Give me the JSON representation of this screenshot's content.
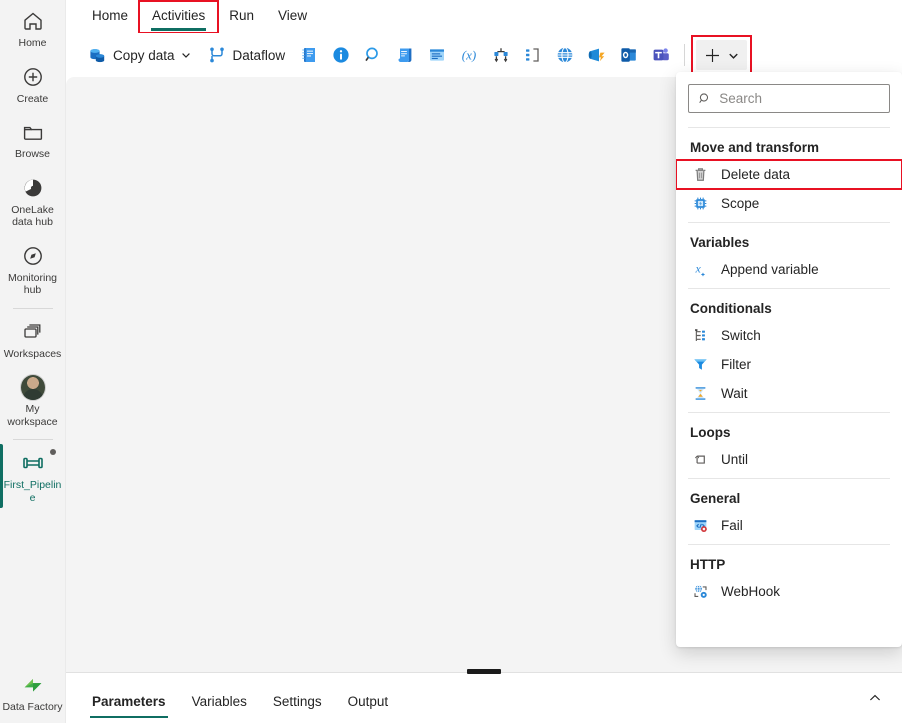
{
  "sidebar": {
    "items": [
      {
        "label": "Home",
        "icon": "home-icon",
        "active": false
      },
      {
        "label": "Create",
        "icon": "plus-circle-icon",
        "active": false
      },
      {
        "label": "Browse",
        "icon": "folder-icon",
        "active": false
      },
      {
        "label": "OneLake data hub",
        "icon": "onelake-icon",
        "active": false
      },
      {
        "label": "Monitoring hub",
        "icon": "monitoring-icon",
        "active": false
      },
      {
        "label": "Workspaces",
        "icon": "workspaces-icon",
        "active": false
      },
      {
        "label": "My workspace",
        "icon": "avatar-icon",
        "active": false
      },
      {
        "label": "First_Pipeline",
        "icon": "pipeline-icon",
        "active": true
      }
    ],
    "footer": {
      "label": "Data Factory",
      "icon": "data-factory-icon"
    }
  },
  "menubar": {
    "tabs": [
      {
        "label": "Home",
        "active": false,
        "highlighted": false
      },
      {
        "label": "Activities",
        "active": true,
        "highlighted": true
      },
      {
        "label": "Run",
        "active": false,
        "highlighted": false
      },
      {
        "label": "View",
        "active": false,
        "highlighted": false
      }
    ]
  },
  "toolbar": {
    "copy_data_label": "Copy data",
    "dataflow_label": "Dataflow",
    "icon_buttons": [
      "notebook-icon",
      "get-metadata-icon",
      "lookup-icon",
      "script-icon",
      "stored-procedure-icon",
      "set-variable-icon",
      "kql-icon",
      "if-condition-icon",
      "web-icon",
      "azure-function-icon",
      "outlook-icon",
      "teams-icon"
    ],
    "add_button": {
      "icon": "plus-icon",
      "chevron": "chevron-down-icon",
      "highlighted": true
    }
  },
  "flyout": {
    "search": {
      "placeholder": "Search",
      "value": "",
      "icon": "search-icon"
    },
    "groups": [
      {
        "title": "Move and transform",
        "items": [
          {
            "label": "Delete data",
            "icon": "trash-icon",
            "highlighted": true
          },
          {
            "label": "Scope",
            "icon": "scope-icon",
            "highlighted": false
          }
        ]
      },
      {
        "title": "Variables",
        "items": [
          {
            "label": "Append variable",
            "icon": "append-variable-icon",
            "highlighted": false
          }
        ]
      },
      {
        "title": "Conditionals",
        "items": [
          {
            "label": "Switch",
            "icon": "switch-icon",
            "highlighted": false
          },
          {
            "label": "Filter",
            "icon": "filter-icon",
            "highlighted": false
          },
          {
            "label": "Wait",
            "icon": "wait-icon",
            "highlighted": false
          }
        ]
      },
      {
        "title": "Loops",
        "items": [
          {
            "label": "Until",
            "icon": "until-icon",
            "highlighted": false
          }
        ]
      },
      {
        "title": "General",
        "items": [
          {
            "label": "Fail",
            "icon": "fail-icon",
            "highlighted": false
          }
        ]
      },
      {
        "title": "HTTP",
        "items": [
          {
            "label": "WebHook",
            "icon": "webhook-icon",
            "highlighted": false
          }
        ]
      }
    ]
  },
  "bottom_panel": {
    "tabs": [
      {
        "label": "Parameters",
        "active": true
      },
      {
        "label": "Variables",
        "active": false
      },
      {
        "label": "Settings",
        "active": false
      },
      {
        "label": "Output",
        "active": false
      }
    ],
    "collapse_icon": "chevron-up-icon"
  },
  "colors": {
    "accent_teal": "#0f6e62",
    "highlight_red": "#e81123",
    "canvas_bg": "#f4f4f4",
    "rail_bg": "#f3f3f3"
  }
}
